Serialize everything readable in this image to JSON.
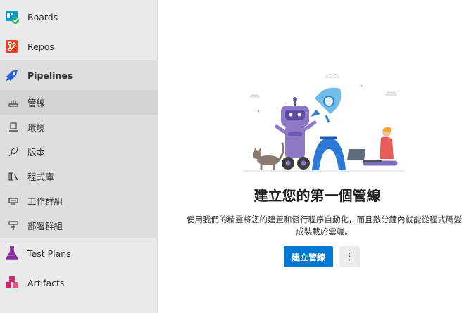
{
  "sidebar": {
    "services": {
      "boards": "Boards",
      "repos": "Repos",
      "pipelines": "Pipelines",
      "test_plans": "Test Plans",
      "artifacts": "Artifacts"
    },
    "pipeline_items": [
      {
        "label": "管線",
        "icon": "pipelines-icon"
      },
      {
        "label": "環境",
        "icon": "environments-icon"
      },
      {
        "label": "版本",
        "icon": "releases-icon"
      },
      {
        "label": "程式庫",
        "icon": "library-icon"
      },
      {
        "label": "工作群組",
        "icon": "task-groups-icon"
      },
      {
        "label": "部署群組",
        "icon": "deployment-groups-icon"
      }
    ]
  },
  "main": {
    "title": "建立您的第一個管線",
    "description_line1": "使用我們的精靈將您的建置和發行程序自動化，而且數分鐘內就能從程式碼變",
    "description_line2": "成裝載於雲端。",
    "primary_button": "建立管線",
    "more_button": "⋮"
  },
  "colors": {
    "accent": "#0078d4",
    "sidebar_bg": "#eaeaea",
    "active_bg": "#d2d2d2"
  }
}
